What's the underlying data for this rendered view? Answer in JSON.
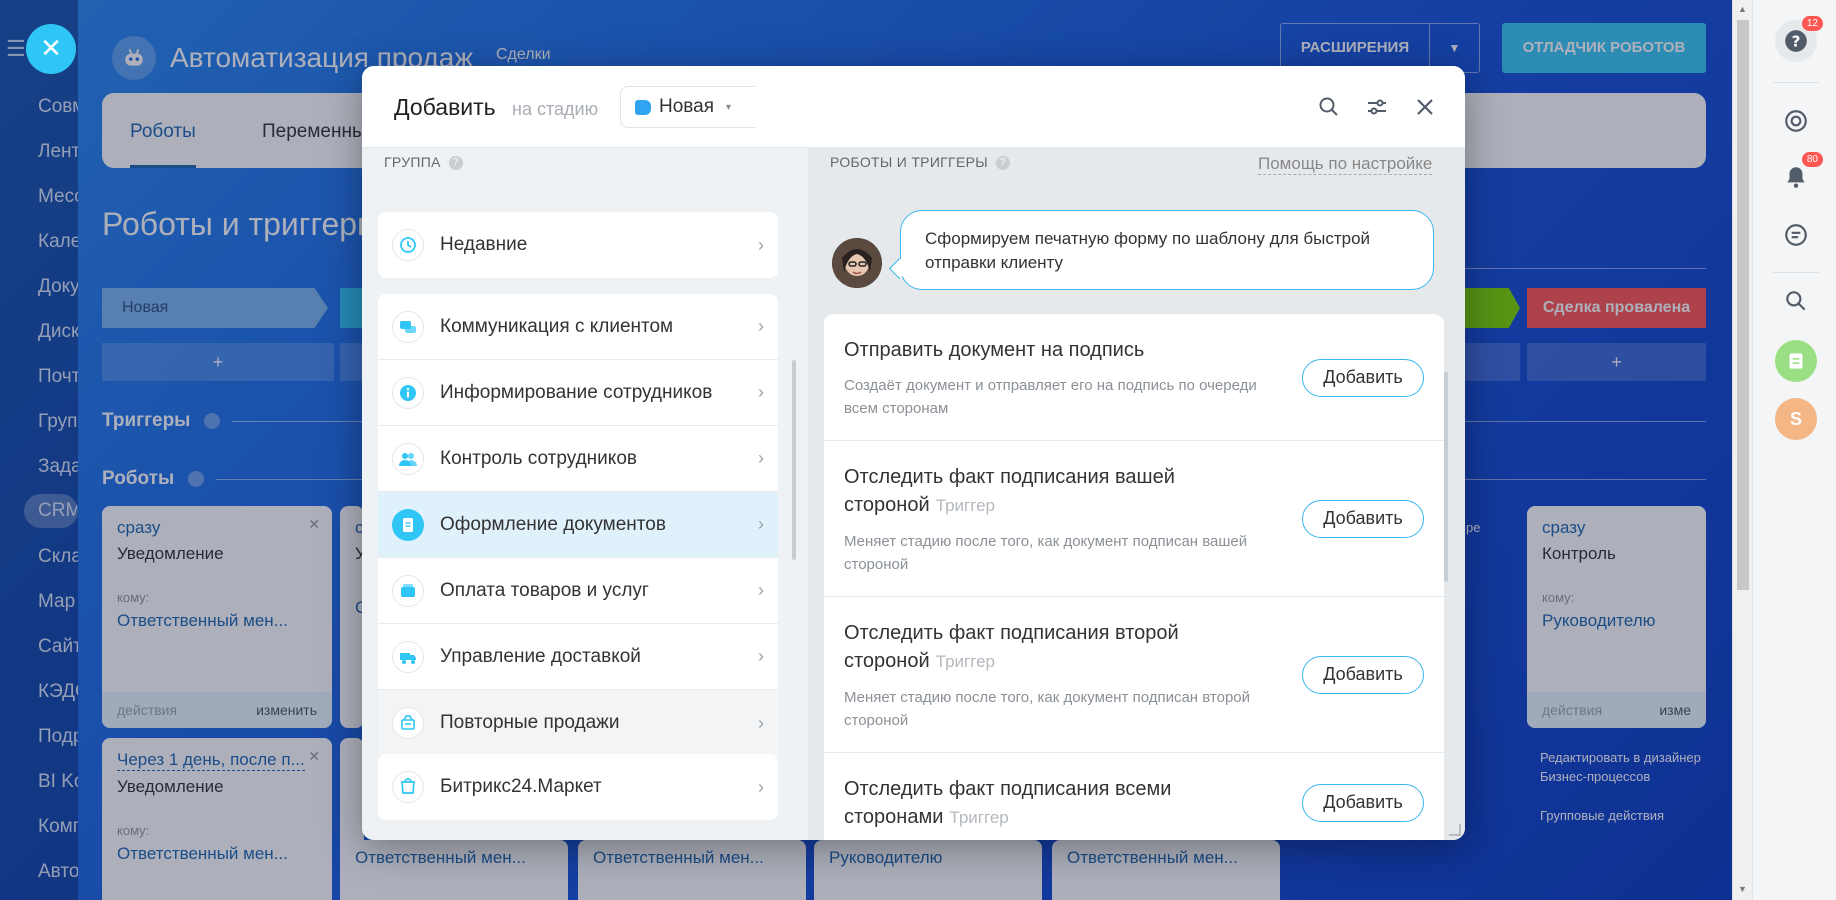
{
  "background": {
    "menu_items": [
      "Совм",
      "Лент",
      "Месс",
      "Кале",
      "Доку",
      "Диск",
      "Почт",
      "Груп",
      "Зада",
      "CRM",
      "Скла",
      "Мар",
      "Сайт",
      "КЭДО",
      "Подр",
      "BI Ko",
      "Комп",
      "Авто"
    ],
    "active_menu_item": "CRM",
    "app_title": "Автоматизация продаж",
    "app_subtitle": "Сделки",
    "extensions_label": "РАСШИРЕНИЯ",
    "debugger_label": "ОТЛАДЧИК РОБОТОВ",
    "tabs": [
      "Роботы",
      "Переменны"
    ],
    "heading": "Роботы и триггеры",
    "stage_new": "Новая",
    "stage_failed": "Сделка провалена",
    "plus": "+",
    "triggers_label": "Триггеры",
    "robots_label": "Роботы",
    "card1": {
      "when": "сразу",
      "kind": "Уведомление",
      "to": "кому:",
      "who": "Ответственный мен...",
      "actions": "действия",
      "edit": "изменить"
    },
    "card2": {
      "when": "Через 1 день, после п...",
      "kind": "Уведомление",
      "to": "кому:",
      "who": "Ответственный мен..."
    },
    "card_right": {
      "when": "сразу",
      "kind": "Контроль",
      "to": "кому:",
      "who": "Руководителю",
      "actions": "действия",
      "edit": "изме"
    },
    "partial_c": "с",
    "partial_u": "У",
    "partial_s": "С",
    "partial_pe": "ре",
    "bottom_who": [
      "Ответственный мен...",
      "Ответственный мен...",
      "Руководителю",
      "Ответственный мен..."
    ],
    "right_links": {
      "designer": "Редактировать в дизайнер Бизнес-процессов",
      "group": "Групповые действия"
    }
  },
  "rail": {
    "help_badge": "12",
    "bell_badge": "80",
    "avatar_letter": "S"
  },
  "modal": {
    "title": "Добавить",
    "stage_label": "на стадию",
    "stage_value": "Новая",
    "group_label": "ГРУППА",
    "group_help": "?",
    "groups_top": [
      {
        "label": "Недавние",
        "icon": "history-icon"
      }
    ],
    "groups": [
      {
        "label": "Коммуникация с клиентом",
        "icon": "chat-icon"
      },
      {
        "label": "Информирование сотрудников",
        "icon": "info-icon"
      },
      {
        "label": "Контроль сотрудников",
        "icon": "people-icon"
      },
      {
        "label": "Оформление документов",
        "icon": "document-icon"
      },
      {
        "label": "Оплата товаров и услуг",
        "icon": "wallet-icon"
      },
      {
        "label": "Управление доставкой",
        "icon": "truck-icon"
      },
      {
        "label": "Повторные продажи",
        "icon": "repeat-sale-icon"
      }
    ],
    "groups_bottom": [
      {
        "label": "Битрикс24.Маркет",
        "icon": "market-icon"
      }
    ],
    "active_group": "Оформление документов",
    "robots_label": "РОБОТЫ И ТРИГГЕРЫ",
    "help_link": "Помощь по настройке",
    "hint": "Сформируем печатную форму по шаблону для быстрой отправки клиенту",
    "add_label": "Добавить",
    "trigger_tag": "Триггер",
    "robots": [
      {
        "title": "Отправить документ на подпись",
        "trigger": false,
        "desc": "Создаёт документ и отправляет его на подпись по очереди всем сторонам"
      },
      {
        "title": "Отследить факт подписания вашей стороной",
        "trigger": true,
        "desc": "Меняет стадию после того, как документ подписан вашей стороной"
      },
      {
        "title": "Отследить факт подписания второй стороной",
        "trigger": true,
        "desc": "Меняет стадию после того, как документ подписан второй стороной"
      },
      {
        "title": "Отследить факт подписания всеми сторонами",
        "trigger": true,
        "desc": ""
      }
    ]
  },
  "colors": {
    "accent": "#2fc6f6",
    "link": "#2067b0",
    "fail": "#ff5752",
    "active_row": "#dff1fb"
  }
}
